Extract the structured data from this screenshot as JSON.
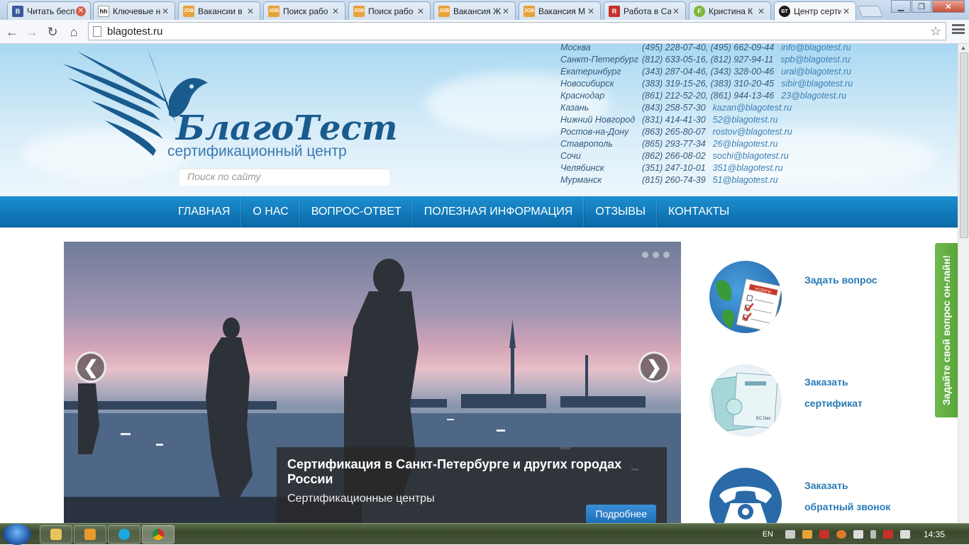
{
  "browser": {
    "tabs": [
      {
        "title": "Читать бесп",
        "favicon": "B"
      },
      {
        "title": "Ключевые н",
        "favicon": "hh"
      },
      {
        "title": "Вакансии в",
        "favicon": "JOB"
      },
      {
        "title": "Поиск рабо",
        "favicon": "JOB"
      },
      {
        "title": "Поиск рабо",
        "favicon": "JOB"
      },
      {
        "title": "Вакансия Ж",
        "favicon": "JOB"
      },
      {
        "title": "Вакансия М",
        "favicon": "JOB"
      },
      {
        "title": "Работа в Са",
        "favicon": "R"
      },
      {
        "title": "Кристина К",
        "favicon": "F"
      },
      {
        "title": "Центр серти",
        "favicon": "БТ"
      }
    ],
    "url": "blagotest.ru"
  },
  "site": {
    "logo_name": "БлагоТест",
    "logo_subtitle": "сертификационный центр",
    "search_placeholder": "Поиск по сайту",
    "contacts": [
      {
        "city": "Москва",
        "phone": "(495) 228-07-40, (495) 662-09-44",
        "email": "info@blagotest.ru"
      },
      {
        "city": "Санкт-Петербург",
        "phone": "(812) 633-05-16, (812) 927-94-11",
        "email": "spb@blagotest.ru"
      },
      {
        "city": "Екатеринбург",
        "phone": "(343) 287-04-46, (343) 328-00-46",
        "email": "ural@blagotest.ru"
      },
      {
        "city": "Новосибирск",
        "phone": "(383) 319-15-26, (383) 310-20-45",
        "email": "sibir@blagotest.ru"
      },
      {
        "city": "Краснодар",
        "phone": "(861) 212-52-20, (861) 944-13-46",
        "email": "23@blagotest.ru"
      },
      {
        "city": "Казань",
        "phone": "(843) 258-57-30",
        "email": "kazan@blagotest.ru"
      },
      {
        "city": "Нижний Новгород",
        "phone": "(831) 414-41-30",
        "email": "52@blagotest.ru"
      },
      {
        "city": "Ростов-на-Дону",
        "phone": "(863) 265-80-07",
        "email": "rostov@blagotest.ru"
      },
      {
        "city": "Ставрополь",
        "phone": "(865) 293-77-34",
        "email": "26@blagotest.ru"
      },
      {
        "city": "Сочи",
        "phone": "(862) 266-08-02",
        "email": "sochi@blagotest.ru"
      },
      {
        "city": "Челябинск",
        "phone": "(351) 247-10-01",
        "email": "351@blagotest.ru"
      },
      {
        "city": "Мурманск",
        "phone": "(815) 260-74-39",
        "email": "51@blagotest.ru"
      }
    ],
    "nav": [
      "ГЛАВНАЯ",
      "О НАС",
      "ВОПРОС-ОТВЕТ",
      "ПОЛЕЗНАЯ ИНФОРМАЦИЯ",
      "ОТЗЫВЫ",
      "КОНТАКТЫ"
    ],
    "slider": {
      "title": "Сертификация в Санкт-Петербурге и других городах России",
      "subtitle": "Сертификационные центры",
      "more_label": "Подробнее",
      "prev": "❮",
      "next": "❯"
    },
    "sidebar": [
      {
        "label_line1": "Задать вопрос",
        "label_line2": "",
        "icon": "services-form-globe-icon",
        "icon_text": "УСЛУГИ"
      },
      {
        "label_line1": "Заказать",
        "label_line2": "сертификат",
        "icon": "certificate-icon",
        "icon_text": "EC Dec"
      },
      {
        "label_line1": "Заказать",
        "label_line2": "обратный звонок",
        "icon": "telephone-icon",
        "icon_text": ""
      }
    ],
    "feedback_tab": "Задайте свой вопрос он-лайн!"
  },
  "taskbar": {
    "language": "EN",
    "clock": "14:35"
  },
  "colors": {
    "nav_bg": "#0a69a8",
    "link": "#2779b6",
    "feedback_bg": "#6fba4e",
    "more_button": "#1f6fb8"
  }
}
